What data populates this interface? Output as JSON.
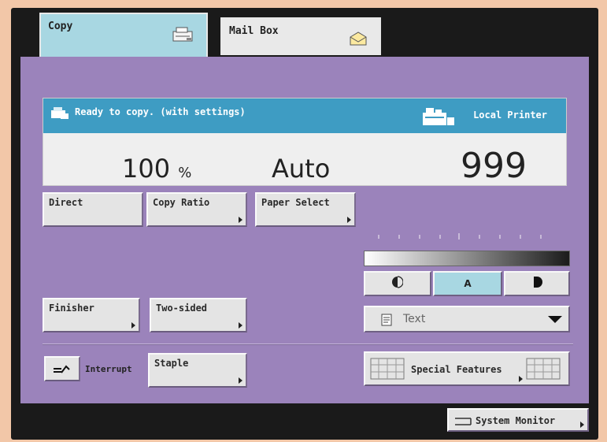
{
  "tabs": {
    "copy_label": "Copy",
    "mailbox_label": "Mail Box"
  },
  "status": {
    "message": "Ready to copy. (with settings)",
    "printer_label": "Local Printer",
    "ratio_value": "100",
    "ratio_unit": "%",
    "paper_value": "Auto",
    "copies_value": "999"
  },
  "buttons": {
    "direct": "Direct",
    "copy_ratio": "Copy Ratio",
    "paper_select": "Paper Select",
    "finisher": "Finisher",
    "two_sided": "Two-sided",
    "staple": "Staple",
    "interrupt": "Interrupt",
    "special_features": "Special Features",
    "system_monitor": "System Monitor"
  },
  "density": {
    "auto_label": "A",
    "selected": "A"
  },
  "image_type": {
    "selected": "Text"
  },
  "colors": {
    "panel": "#9b83bb",
    "status_bar": "#3e9cc3",
    "active_tab": "#a8d7e2",
    "frame": "#f2c7a8"
  },
  "icons": {
    "copy_tab": "copier-icon",
    "mailbox_tab": "envelope-icon",
    "status": "copier-small-icon",
    "printer": "printer-icon",
    "interrupt": "interrupt-icon",
    "text_mode": "document-icon",
    "special_features": "grid-icon",
    "system_monitor": "monitor-icon"
  }
}
